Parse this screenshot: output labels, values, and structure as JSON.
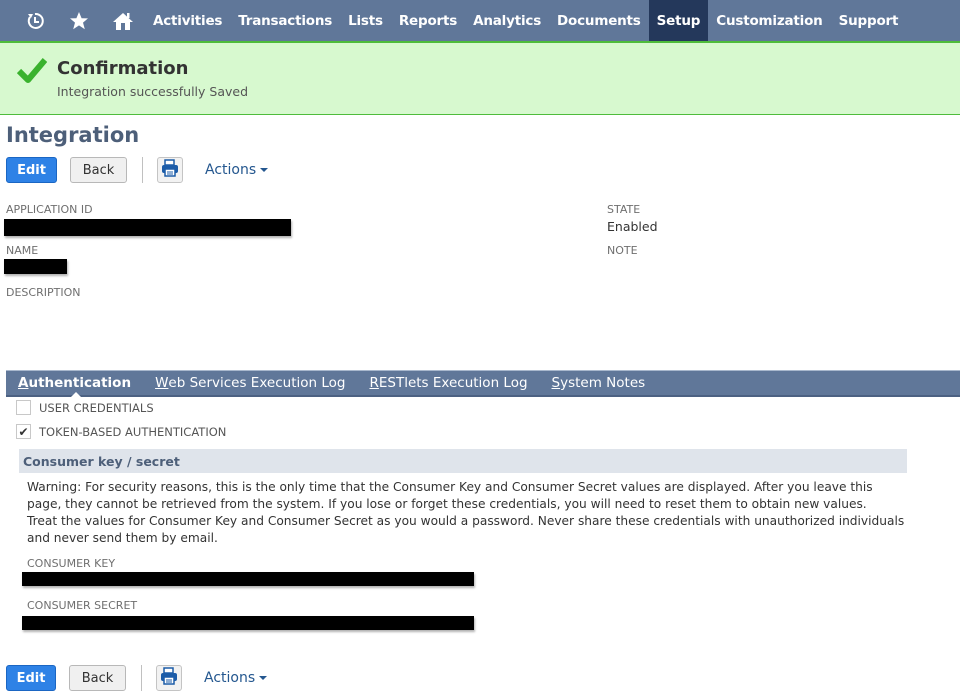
{
  "nav": {
    "icons": [
      "recent-records-icon",
      "star-icon",
      "home-icon"
    ],
    "items": [
      "Activities",
      "Transactions",
      "Lists",
      "Reports",
      "Analytics",
      "Documents",
      "Setup",
      "Customization",
      "Support"
    ],
    "active": "Setup"
  },
  "confirmation": {
    "title": "Confirmation",
    "message": "Integration successfully Saved"
  },
  "page": {
    "title": "Integration"
  },
  "toolbar": {
    "edit_label": "Edit",
    "back_label": "Back",
    "actions_label": "Actions"
  },
  "fields": {
    "application_id_label": "APPLICATION ID",
    "application_id_value": "[redacted]",
    "name_label": "NAME",
    "name_value": "[redacted]",
    "description_label": "DESCRIPTION",
    "state_label": "STATE",
    "state_value": "Enabled",
    "note_label": "NOTE"
  },
  "tabs": [
    {
      "label_first": "A",
      "label_rest": "uthentication",
      "active": true
    },
    {
      "label_first": "W",
      "label_rest": "eb Services Execution Log",
      "active": false
    },
    {
      "label_first": "R",
      "label_rest": "ESTlets Execution Log",
      "active": false
    },
    {
      "label_first": "S",
      "label_rest": "ystem Notes",
      "active": false
    }
  ],
  "auth": {
    "user_credentials_label": "USER CREDENTIALS",
    "user_credentials_checked": false,
    "token_based_label": "TOKEN-BASED AUTHENTICATION",
    "token_based_checked": true,
    "section_title": "Consumer key / secret",
    "warning_line1": "Warning: For security reasons, this is the only time that the Consumer Key and Consumer Secret values are displayed. After you leave this page, they cannot be retrieved from the system. If you lose or forget these credentials, you will need to reset them to obtain new values.",
    "warning_line2": "Treat the values for Consumer Key and Consumer Secret as you would a password. Never share these credentials with unauthorized individuals and never send them by email.",
    "consumer_key_label": "CONSUMER KEY",
    "consumer_key_value": "[redacted]",
    "consumer_secret_label": "CONSUMER SECRET",
    "consumer_secret_value": "[redacted]"
  },
  "colors": {
    "nav_bg": "#607799",
    "nav_active": "#24385b",
    "confirm_bg": "#d7f9cf",
    "confirm_border": "#4ebc3b",
    "primary_button": "#2e82e6"
  }
}
